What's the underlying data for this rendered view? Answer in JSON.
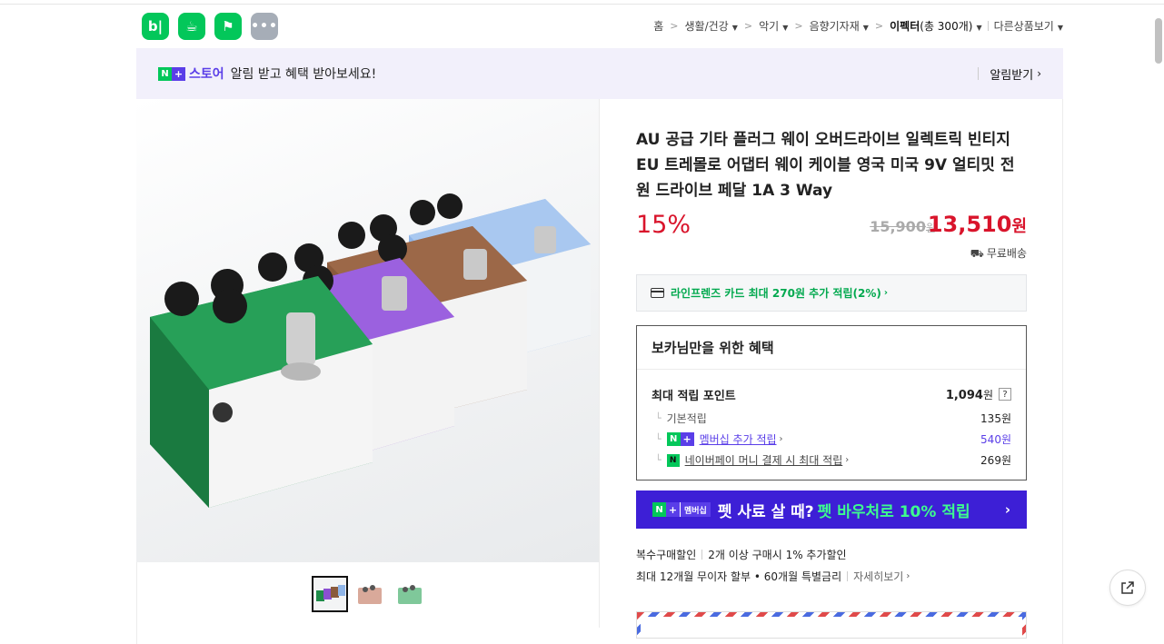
{
  "header": {
    "apps": [
      {
        "name": "blog",
        "label": "b|"
      },
      {
        "name": "cafe",
        "label": "☕"
      },
      {
        "name": "store",
        "label": "⚑"
      },
      {
        "name": "more",
        "label": "•••"
      }
    ]
  },
  "breadcrumb": {
    "items": [
      {
        "label": "홈",
        "caret": false
      },
      {
        "label": "생활/건강",
        "caret": true
      },
      {
        "label": "악기",
        "caret": true
      },
      {
        "label": "음향기자재",
        "caret": true
      },
      {
        "label": "이펙터",
        "count": "(총 300개)",
        "caret": true
      }
    ],
    "other": "다른상품보기"
  },
  "banner": {
    "store_label": "스토어",
    "message": "알림 받고 혜택 받아보세요!",
    "action": "알림받기"
  },
  "product": {
    "title": "AU 공급 기타 플러그 웨이 오버드라이브 일렉트릭 빈티지 EU 트레몰로 어댑터 웨이 케이블 영국 미국 9V 얼티밋 전원 드라이브 페달 1A 3 Way",
    "discount": "15%",
    "original_price": "15,900",
    "original_unit": "원",
    "price": "13,510",
    "price_unit": "원",
    "shipping": "무료배송"
  },
  "card_promo": {
    "text": "라인프렌즈 카드 최대 270원 추가 적립(2%)"
  },
  "benefits": {
    "title": "보카님만을 위한 혜택",
    "max_point_label": "최대 적립 포인트",
    "max_point_value": "1,094",
    "unit": "원",
    "help": "?",
    "rows": [
      {
        "label": "기본적립",
        "amount": "135원"
      },
      {
        "label": "멤버십 추가 적립",
        "amount": "540원"
      },
      {
        "label": "네이버페이 머니 결제 시 최대 적립",
        "amount": "269원"
      }
    ]
  },
  "membership_promo": {
    "badge": "멤버십",
    "text_white": "펫 사료 살 때?",
    "text_green": "펫 바우처로 10% 적립"
  },
  "extras": {
    "multi_label": "복수구매할인",
    "multi_text": "2개 이상 구매시 1% 추가할인",
    "installment": "최대 12개월 무이자 할부 • 60개월 특별금리",
    "details": "자세히보기"
  },
  "colors": {
    "naver_green": "#03c75a",
    "store_purple": "#5a3ee8",
    "price_red": "#d9142b",
    "promo_blue": "#3d1fd6"
  }
}
